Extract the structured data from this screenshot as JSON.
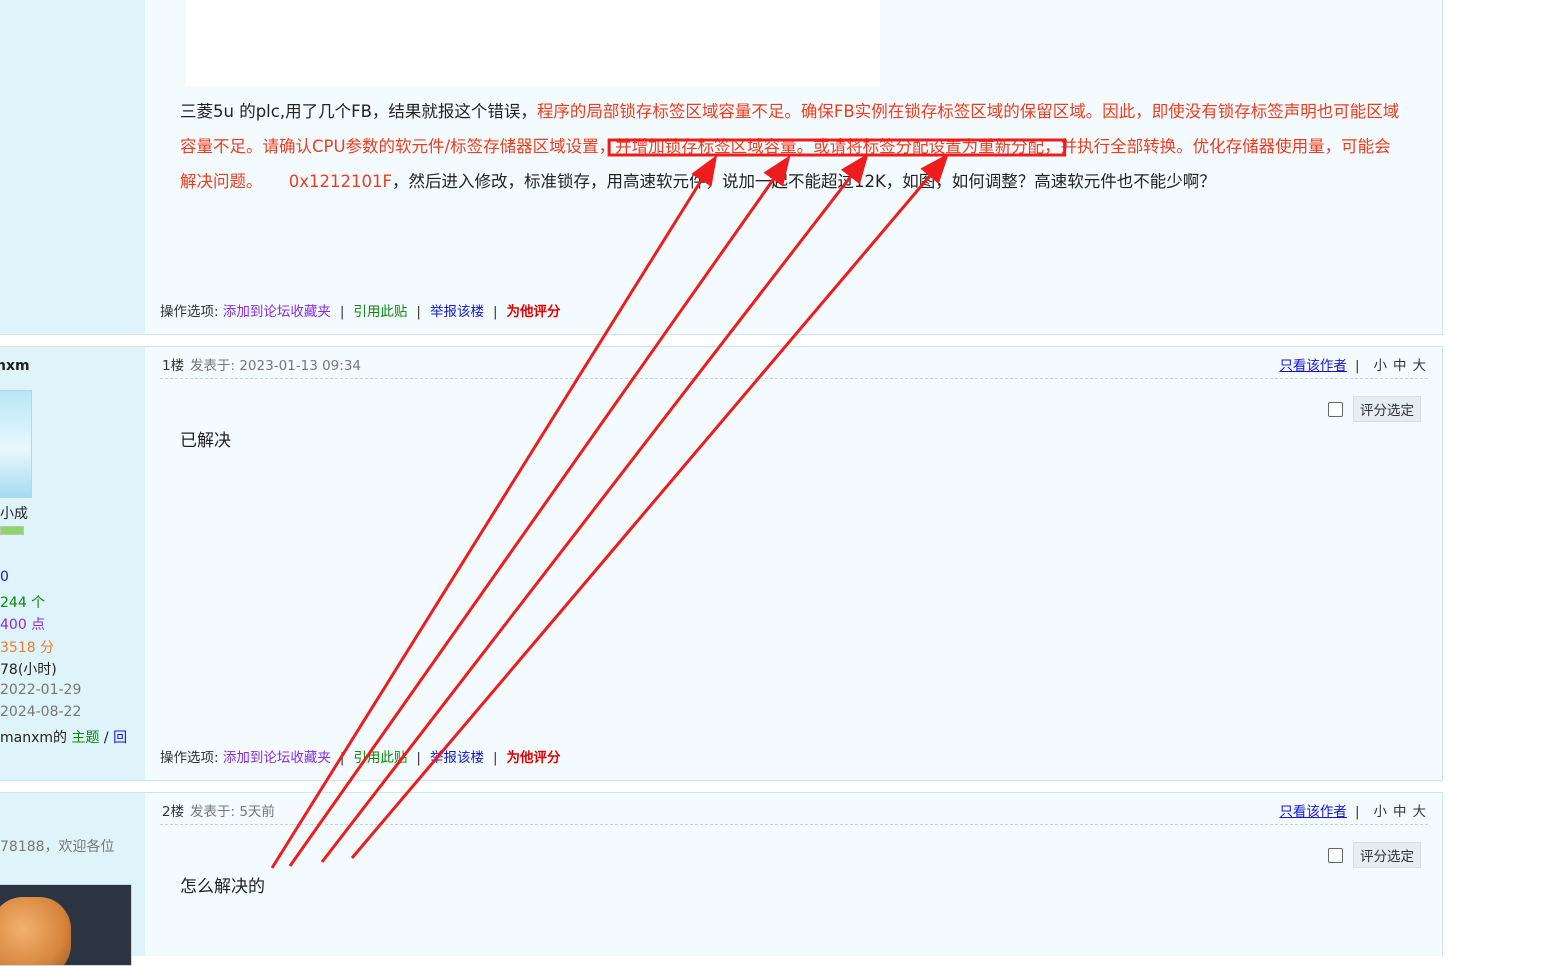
{
  "post0": {
    "text_intro": "三菱5u 的plc,用了几个FB，结果就报这个错误，",
    "text_error_a": "程序的局部锁存标签区域容量不足。确保FB实例在锁存标签区域的保留区域。因此，即使没有锁存标签声明也可能区域容量不足。请确认CPU参数的软元件/标签存储器区域设置，",
    "text_error_highlight": "并增加锁存标签区域容量。或请将标签分配设置为重新分配，",
    "text_error_b": "并执行全部转换。优化存储器使用量，可能会解决问题。",
    "error_code": "0x1212101F",
    "text_tail": "，然后进入修改，标准锁存，用高速软元件，说加一起不能超过12K，如图，如何调整？高速软元件也不能少啊？"
  },
  "ops": {
    "label": "操作选项:",
    "add_fav": "添加到论坛收藏夹",
    "quote": "引用此贴",
    "report": "举报该楼",
    "rate": "为他评分",
    "sep": "|"
  },
  "post1": {
    "floor": "1楼",
    "date": "发表于: 2023-01-13 09:34",
    "only_author": "只看该作者",
    "sizes": [
      "小",
      "中",
      "大"
    ],
    "rate_select": "评分选定",
    "text": "已解决"
  },
  "post2": {
    "floor": "2楼",
    "date": "发表于: 5天前",
    "only_author": "只看该作者",
    "sizes": [
      "小",
      "中",
      "大"
    ],
    "rate_select": "评分选定",
    "text": "怎么解决的"
  },
  "sidebar1": {
    "username": "nxm",
    "level": "小成",
    "stat1": "0",
    "stat2": "244 个",
    "stat3": "400 点",
    "stat4": "3518 分",
    "stat5": "78(小时)",
    "reg_date": "2022-01-29",
    "last_date": "2024-08-22",
    "threads_prefix": "manxm的",
    "threads_link": "主题",
    "threads_sep": "/",
    "threads_reply": "回"
  },
  "sidebar2": {
    "signature": "78188，欢迎各位"
  },
  "colors": {
    "accent_red": "#f03c1e",
    "annotation_red": "#ee1c1c",
    "link_blue": "#1515d6",
    "link_green": "#0a8a0a",
    "link_purple": "#8a2be2",
    "sidebar_bg": "#dff3fb",
    "content_bg": "#f4fbfe"
  }
}
